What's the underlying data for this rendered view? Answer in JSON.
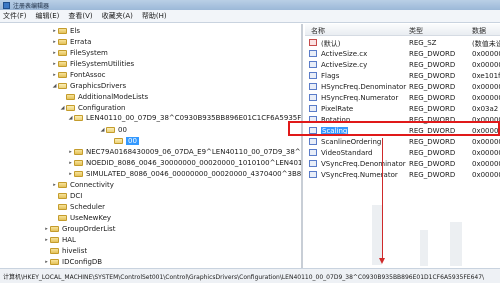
{
  "window": {
    "title": "注册表编辑器"
  },
  "menu": [
    "文件(F)",
    "编辑(E)",
    "查看(V)",
    "收藏夹(A)",
    "帮助(H)"
  ],
  "tree": [
    {
      "label": "Els",
      "arrow": "▸",
      "open": false,
      "selected": false
    },
    {
      "label": "Errata",
      "arrow": "▸",
      "open": false,
      "selected": false
    },
    {
      "label": "FileSystem",
      "arrow": "▸",
      "open": false,
      "selected": false
    },
    {
      "label": "FileSystemUtilities",
      "arrow": "▸",
      "open": false,
      "selected": false
    },
    {
      "label": "FontAssoc",
      "arrow": "▸",
      "open": false,
      "selected": false
    },
    {
      "label": "GraphicsDrivers",
      "arrow": "◢",
      "open": true,
      "selected": false
    },
    {
      "label": "AdditionalModeLists",
      "arrow": "",
      "open": false,
      "selected": false
    },
    {
      "label": "Configuration",
      "arrow": "◢",
      "open": true,
      "selected": false
    },
    {
      "label": "LEN40110_00_07D9_38^C0930B935BB896E01C1CF6A5935FE647",
      "arrow": "◢",
      "open": true,
      "selected": false
    },
    {
      "label": "00",
      "arrow": "◢",
      "open": true,
      "selected": false
    },
    {
      "label": "00",
      "arrow": "",
      "open": true,
      "selected": true
    },
    {
      "label": "NEC79A0168430009_06_07DA_E9^LEN40110_00_07D9_38^43B5E9C",
      "arrow": "▸",
      "open": false,
      "selected": false
    },
    {
      "label": "NOEDID_8086_0046_30000000_00020000_1010100^LEN40110_00_",
      "arrow": "▸",
      "open": false,
      "selected": false
    },
    {
      "label": "SIMULATED_8086_0046_00000000_00020000_4370400^3B83A8FC",
      "arrow": "▸",
      "open": false,
      "selected": false
    },
    {
      "label": "Connectivity",
      "arrow": "▸",
      "open": false,
      "selected": false
    },
    {
      "label": "DCI",
      "arrow": "",
      "open": false,
      "selected": false
    },
    {
      "label": "Scheduler",
      "arrow": "",
      "open": false,
      "selected": false
    },
    {
      "label": "UseNewKey",
      "arrow": "",
      "open": false,
      "selected": false
    },
    {
      "label": "GroupOrderList",
      "arrow": "▸",
      "open": false,
      "selected": false
    },
    {
      "label": "HAL",
      "arrow": "▸",
      "open": false,
      "selected": false
    },
    {
      "label": "hivelist",
      "arrow": "",
      "open": false,
      "selected": false
    },
    {
      "label": "IDConfigDB",
      "arrow": "▸",
      "open": false,
      "selected": false
    }
  ],
  "list": {
    "headers": {
      "name": "名称",
      "type": "类型",
      "data": "数据"
    },
    "rows": [
      {
        "name": "(默认)",
        "type": "REG_SZ",
        "data": "(数值未设置)",
        "kind": "str",
        "selected": false
      },
      {
        "name": "ActiveSize.cx",
        "type": "REG_DWORD",
        "data": "0x00000",
        "kind": "bin",
        "selected": false
      },
      {
        "name": "ActiveSize.cy",
        "type": "REG_DWORD",
        "data": "0x00000",
        "kind": "bin",
        "selected": false
      },
      {
        "name": "Flags",
        "type": "REG_DWORD",
        "data": "0xe101f",
        "kind": "bin",
        "selected": false
      },
      {
        "name": "HSyncFreq.Denominator",
        "type": "REG_DWORD",
        "data": "0x00000",
        "kind": "bin",
        "selected": false
      },
      {
        "name": "HSyncFreq.Numerator",
        "type": "REG_DWORD",
        "data": "0x00000",
        "kind": "bin",
        "selected": false
      },
      {
        "name": "PixelRate",
        "type": "REG_DWORD",
        "data": "0x03a2",
        "kind": "bin",
        "selected": false
      },
      {
        "name": "Rotation",
        "type": "REG_DWORD",
        "data": "0x00000",
        "kind": "bin",
        "selected": false
      },
      {
        "name": "Scaling",
        "type": "REG_DWORD",
        "data": "0x00000",
        "kind": "bin",
        "selected": true
      },
      {
        "name": "ScanlineOrdering",
        "type": "REG_DWORD",
        "data": "0x00000",
        "kind": "bin",
        "selected": false
      },
      {
        "name": "VideoStandard",
        "type": "REG_DWORD",
        "data": "0x00000",
        "kind": "bin",
        "selected": false
      },
      {
        "name": "VSyncFreq.Denominator",
        "type": "REG_DWORD",
        "data": "0x00000",
        "kind": "bin",
        "selected": false
      },
      {
        "name": "VSyncFreq.Numerator",
        "type": "REG_DWORD",
        "data": "0x00000",
        "kind": "bin",
        "selected": false
      }
    ]
  },
  "status": "计算机\\HKEY_LOCAL_MACHINE\\SYSTEM\\ControlSet001\\Control\\GraphicsDrivers\\Configuration\\LEN40110_00_07D9_38^C0930B935BB896E01D1CF6A5935FE647\\",
  "colors": {
    "annotation": "#e01919",
    "selection": "#3399ff"
  }
}
